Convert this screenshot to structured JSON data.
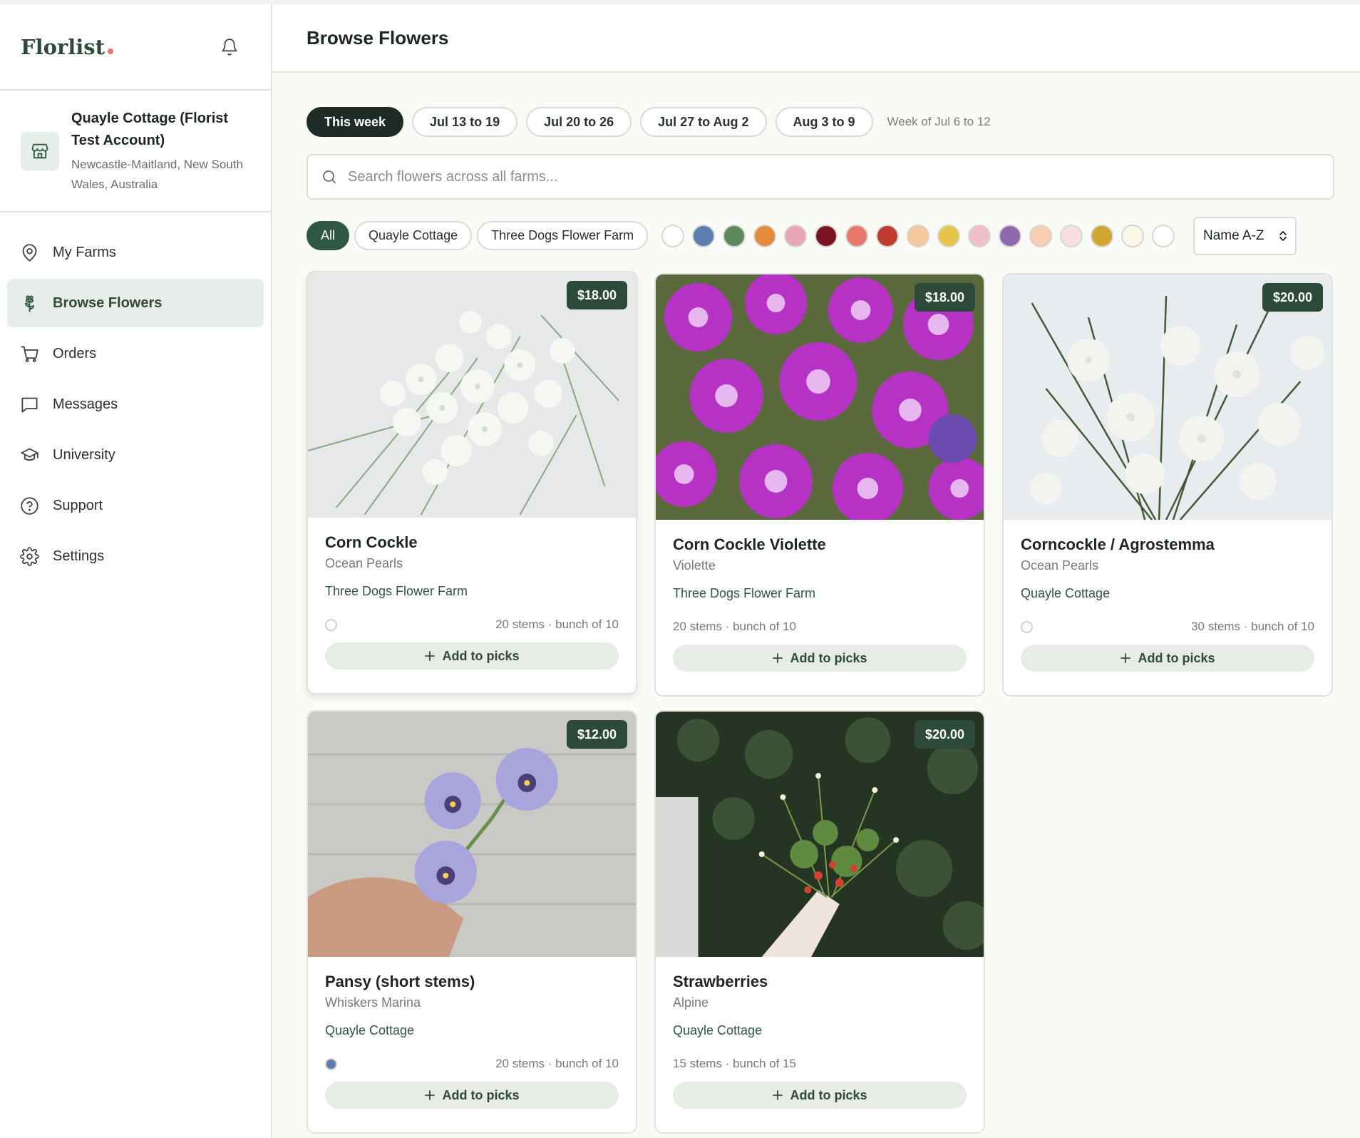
{
  "app": {
    "brand": "Florlist"
  },
  "account": {
    "name": "Quayle Cottage (Florist Test Account)",
    "location": "Newcastle-Maitland, New South Wales, Australia"
  },
  "nav": [
    {
      "label": "My Farms",
      "icon": "map-pin-icon"
    },
    {
      "label": "Browse Flowers",
      "icon": "flower-icon",
      "active": true
    },
    {
      "label": "Orders",
      "icon": "cart-icon"
    },
    {
      "label": "Messages",
      "icon": "message-icon"
    },
    {
      "label": "University",
      "icon": "graduation-cap-icon"
    },
    {
      "label": "Support",
      "icon": "help-circle-icon"
    },
    {
      "label": "Settings",
      "icon": "gear-icon"
    }
  ],
  "header": {
    "title": "Browse Flowers"
  },
  "weeks": {
    "options": [
      "This week",
      "Jul 13 to 19",
      "Jul 20 to 26",
      "Jul 27 to Aug 2",
      "Aug 3 to 9"
    ],
    "selected": "This week",
    "note": "Week of Jul 6 to 12"
  },
  "search": {
    "placeholder": "Search flowers across all farms..."
  },
  "farm_filters": {
    "options": [
      "All",
      "Quayle Cottage",
      "Three Dogs Flower Farm"
    ],
    "selected": "All"
  },
  "color_swatches": [
    "#ffffff",
    "#5b7fb0",
    "#5d8a5a",
    "#e58a3a",
    "#e8a6b8",
    "#7a1420",
    "#e8786a",
    "#c03c2e",
    "#f6c79a",
    "#e9c44a",
    "#f0bfc8",
    "#8e69ad",
    "#f7cfae",
    "#f8dde2",
    "#d2a532",
    "#fbf8e6",
    "#ffffff"
  ],
  "sort": {
    "value": "Name A-Z"
  },
  "cards": [
    {
      "name": "Corn Cockle",
      "variety": "Ocean Pearls",
      "farm": "Three Dogs Flower Farm",
      "price": "$18.00",
      "stems": "20 stems · bunch of 10",
      "color_dot": "#ffffff",
      "add_label": "Add to picks"
    },
    {
      "name": "Corn Cockle Violette",
      "variety": "Violette",
      "farm": "Three Dogs Flower Farm",
      "price": "$18.00",
      "stems": "20 stems · bunch of 10",
      "color_dot": null,
      "add_label": "Add to picks"
    },
    {
      "name": "Corncockle / Agrostemma",
      "variety": "Ocean Pearls",
      "farm": "Quayle Cottage",
      "price": "$20.00",
      "stems": "30 stems · bunch of 10",
      "color_dot": "#ffffff",
      "add_label": "Add to picks"
    },
    {
      "name": "Pansy (short stems)",
      "variety": "Whiskers Marina",
      "farm": "Quayle Cottage",
      "price": "$12.00",
      "stems": "20 stems · bunch of 10",
      "color_dot": "#5b7fb0",
      "add_label": "Add to picks"
    },
    {
      "name": "Strawberries",
      "variety": "Alpine",
      "farm": "Quayle Cottage",
      "price": "$20.00",
      "stems": "15 stems · bunch of 15",
      "color_dot": null,
      "add_label": "Add to picks"
    }
  ]
}
